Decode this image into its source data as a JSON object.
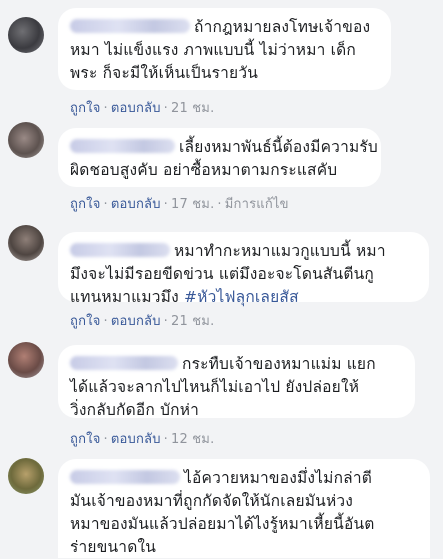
{
  "comments": [
    {
      "lines": [
        "ถ้ากฎหมายลงโทษเจ้าของ",
        "หมา ไม่แข็งแรง ภาพแบบนี้ ไม่ว่าหมา เด็ก",
        "พระ ก็จะมีให้เห็นเป็นรายวัน"
      ],
      "like": "ถูกใจ",
      "reply": "ตอบกลับ",
      "time": "21 ชม."
    },
    {
      "lines": [
        "เลี้ยงหมาพันธ์นี้ต้องมีความรับ",
        "ผิดชอบสูงคับ อย่าซื้อหมาตามกระแสคับ"
      ],
      "like": "ถูกใจ",
      "reply": "ตอบกลับ",
      "time": "17 ชม.",
      "edited": "มีการแก้ไข"
    },
    {
      "lines": [
        "หมาทำกะหมาแมวกูแบบนี้ หมา",
        "มึงจะไม่มีรอยขีดข่วน แต่มึงอะจะโดนสันตีนกู",
        "แทนหมาแมวมึง "
      ],
      "hashtag": "#หัวไฟลุกเลยสัส",
      "like": "ถูกใจ",
      "reply": "ตอบกลับ",
      "time": "21 ชม."
    },
    {
      "lines": [
        "กระทืบเจ้าของหมาแม่ม แยก",
        "ได้แล้วจะลากไปไหนก็ไม่เอาไป ยังปล่อยให้",
        "วิ่งกลับกัดอีก บักห่า"
      ],
      "like": "ถูกใจ",
      "reply": "ตอบกลับ",
      "time": "12 ชม."
    },
    {
      "lines": [
        "ไอ้ควายหมาของมึ่งไม่กล่าตี",
        "มันเจ้าของหมาที่ถูกกัดจัดให้นักเลยมันห่วง",
        "หมาของมันแล้วปล่อยมาได้ไงรู้หมาเหี้ยนี้อันต",
        "ร่ายขนาดใน"
      ]
    }
  ],
  "separator": "·",
  "colors": {
    "background": "#f2f3f5",
    "bubble": "#ffffff",
    "link": "#385898",
    "meta": "#90949c"
  }
}
